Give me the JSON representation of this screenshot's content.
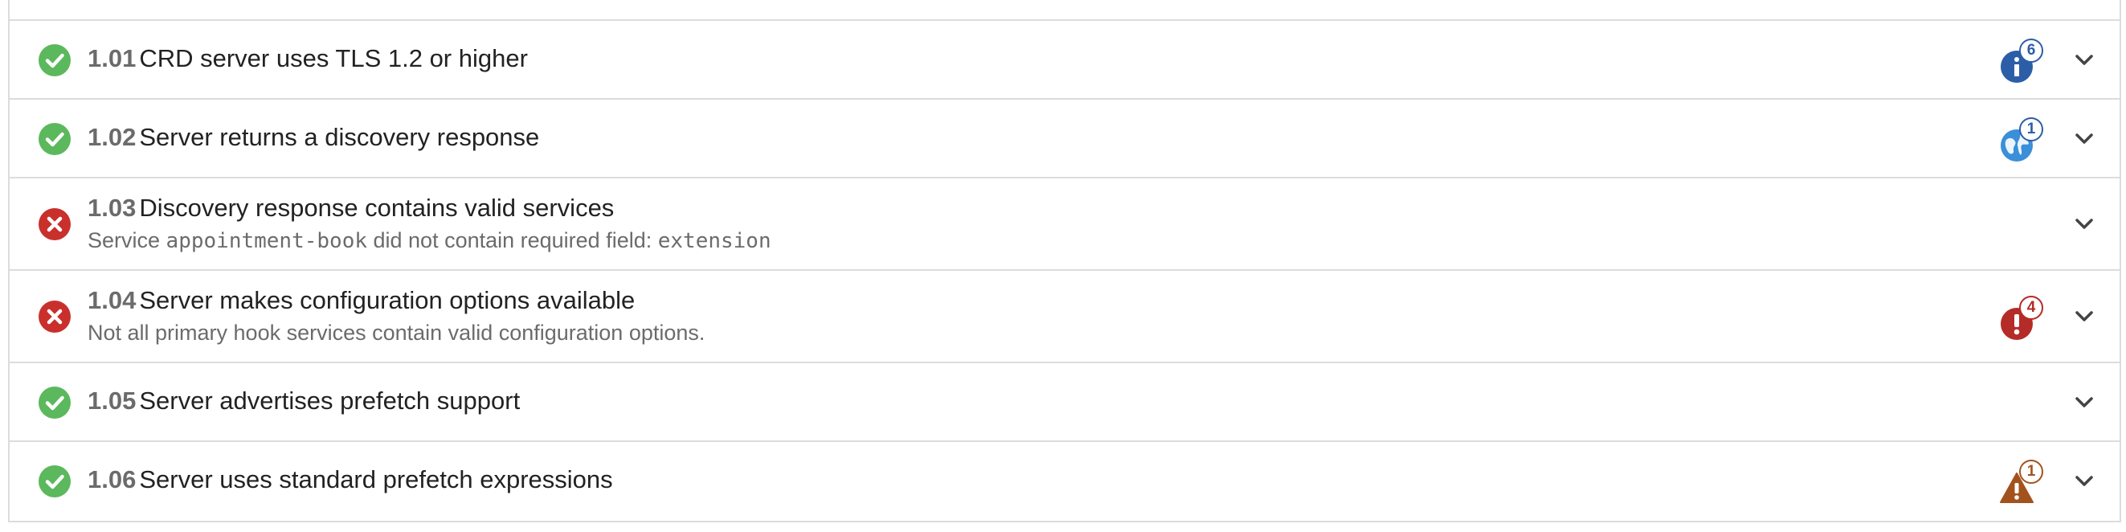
{
  "colors": {
    "pass": "#5cb85c",
    "fail": "#c9302c",
    "info": "#2c5ea8",
    "globe": "#3a8fd8",
    "error_badge": "#b52b27",
    "warning": "#a3521e"
  },
  "tests": [
    {
      "number": "1.01",
      "title": "CRD server uses TLS 1.2 or higher",
      "status": "pass",
      "badge": {
        "icon": "info-icon",
        "count": "6"
      }
    },
    {
      "number": "1.02",
      "title": "Server returns a discovery response",
      "status": "pass",
      "badge": {
        "icon": "globe-icon",
        "count": "1"
      }
    },
    {
      "number": "1.03",
      "title": "Discovery response contains valid services",
      "status": "fail",
      "detail": {
        "prefix": "Service ",
        "code1": "appointment-book",
        "middle": " did not contain required field: ",
        "code2": "extension"
      }
    },
    {
      "number": "1.04",
      "title": "Server makes configuration options available",
      "status": "fail",
      "detail": "Not all primary hook services contain valid configuration options.",
      "badge": {
        "icon": "error-icon",
        "count": "4"
      }
    },
    {
      "number": "1.05",
      "title": "Server advertises prefetch support",
      "status": "pass"
    },
    {
      "number": "1.06",
      "title": "Server uses standard prefetch expressions",
      "status": "pass",
      "badge": {
        "icon": "warning-icon",
        "count": "1"
      }
    }
  ]
}
